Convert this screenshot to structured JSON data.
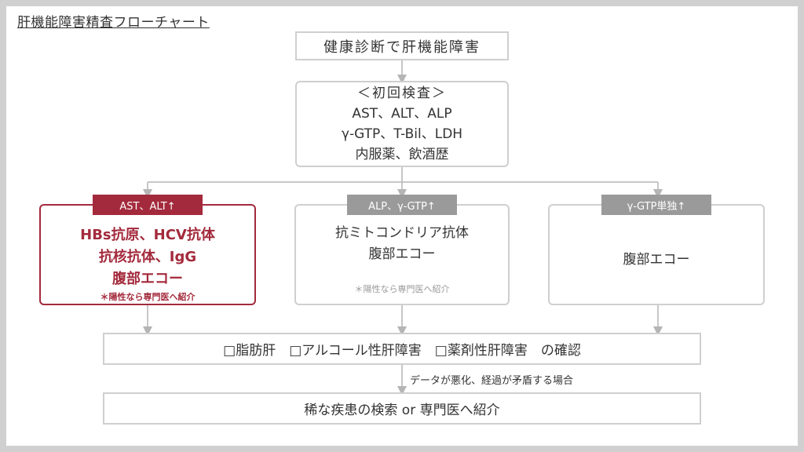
{
  "title": "肝機能障害精査フローチャート",
  "start": "健康診断で肝機能障害",
  "initial_tests": [
    "＜初回検査＞",
    "AST、ALT、ALP",
    "γ-GTP、T-Bil、LDH",
    "内服薬、飲酒歴"
  ],
  "branches": [
    {
      "tag": "AST、ALT↑",
      "lines": [
        "HBs抗原、HCV抗体",
        "抗核抗体、IgG",
        "腹部エコー"
      ],
      "note": "＊陽性なら専門医へ紹介"
    },
    {
      "tag": "ALP、γ-GTP↑",
      "lines": [
        "抗ミトコンドリア抗体",
        "腹部エコー"
      ],
      "note": "＊陽性なら専門医へ紹介"
    },
    {
      "tag": "γ-GTP単独↑",
      "lines": [
        "腹部エコー"
      ],
      "note": ""
    }
  ],
  "confirm": "□脂肪肝　□アルコール性肝障害　□薬剤性肝障害　の確認",
  "edge_label": "データが悪化、経過が矛盾する場合",
  "final": "稀な疾患の検索 or 専門医へ紹介",
  "colors": {
    "accent": "#a32a3c",
    "tag_gray": "#9a9a9a",
    "border": "#cfcfcf",
    "arrow": "#b5b5b5"
  }
}
